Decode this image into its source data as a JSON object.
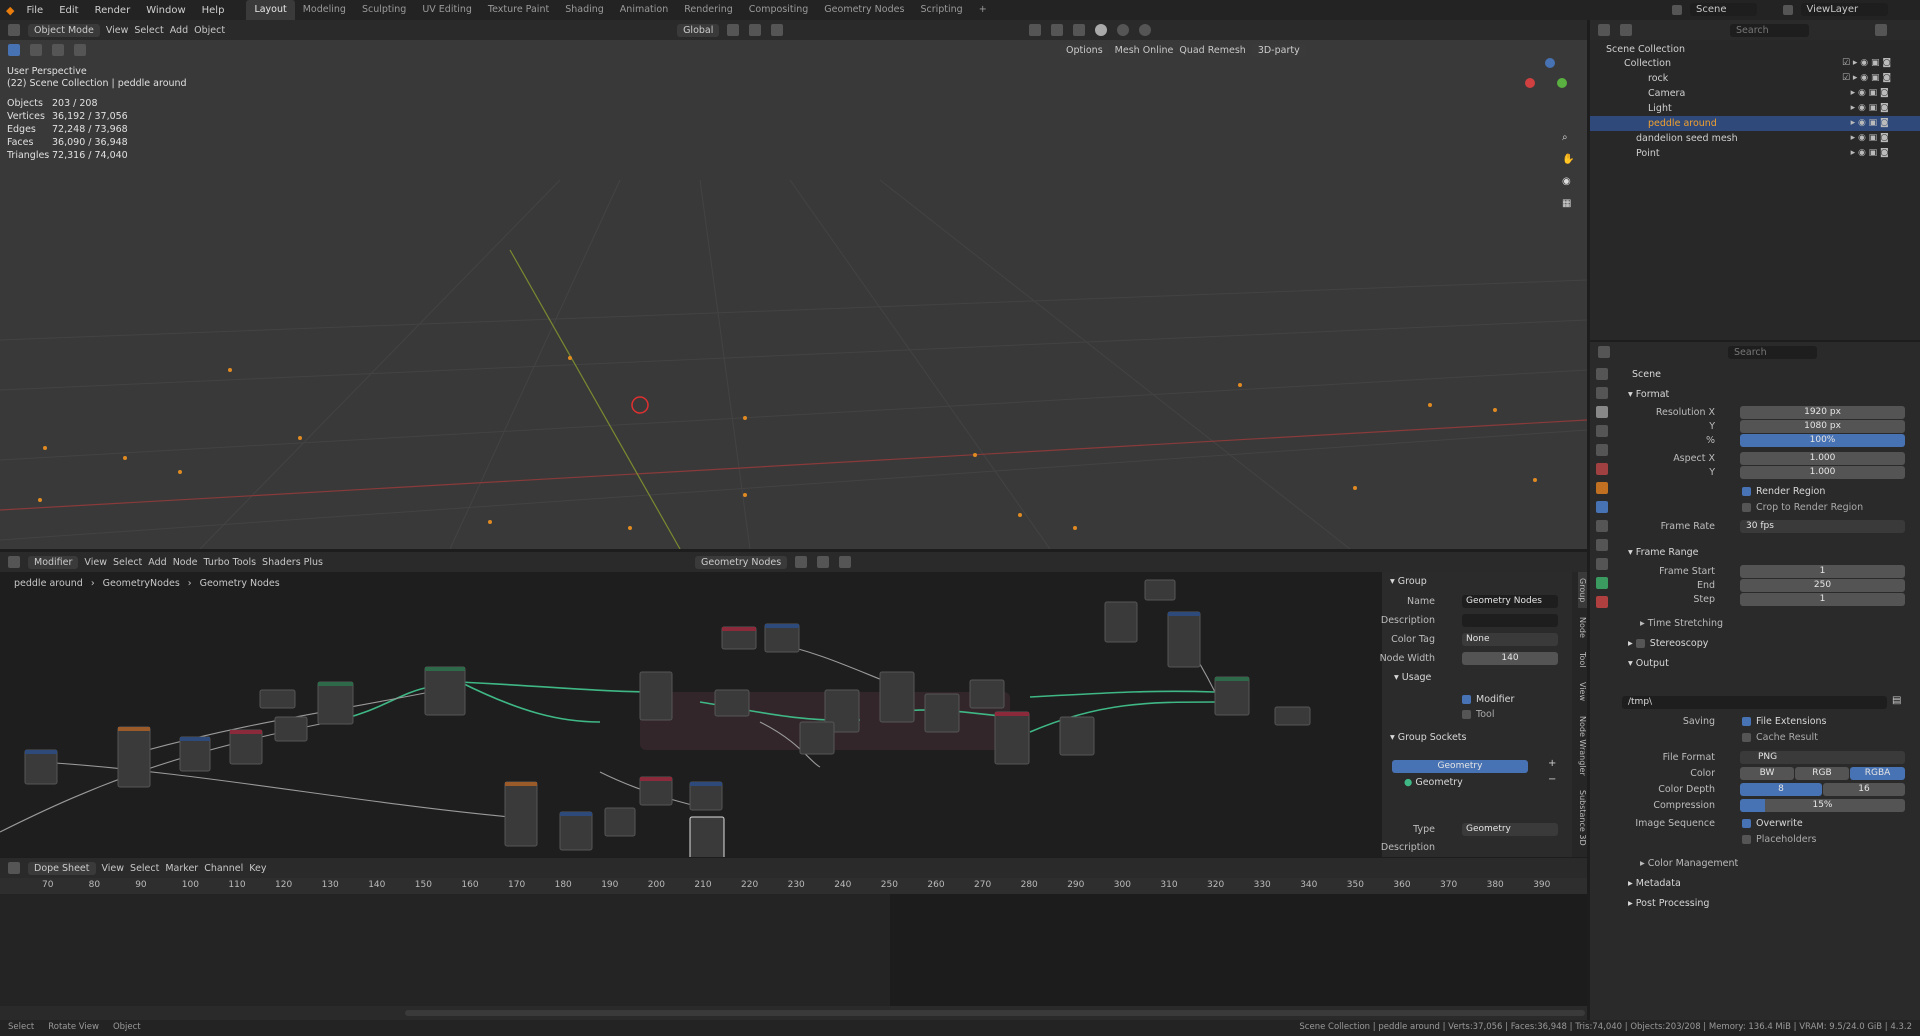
{
  "topbar": {
    "menus": [
      "File",
      "Edit",
      "Render",
      "Window",
      "Help"
    ],
    "workspaces": [
      "Layout",
      "Modeling",
      "Sculpting",
      "UV Editing",
      "Texture Paint",
      "Shading",
      "Animation",
      "Rendering",
      "Compositing",
      "Geometry Nodes",
      "Scripting"
    ],
    "active_workspace": "Layout",
    "scene": "Scene",
    "view_layer": "ViewLayer"
  },
  "viewport_header": {
    "mode": "Object Mode",
    "menus": [
      "View",
      "Select",
      "Add",
      "Object"
    ],
    "transform": "Global",
    "options": "Options",
    "addons": [
      "Mesh Online",
      "Quad Remesh",
      "3D-party"
    ]
  },
  "viewport": {
    "perspective": "User Perspective",
    "collection": "(22) Scene Collection | peddle around",
    "stats": [
      {
        "label": "Objects",
        "value": "203 / 208"
      },
      {
        "label": "Vertices",
        "value": "36,192 / 37,056"
      },
      {
        "label": "Edges",
        "value": "72,248 / 73,968"
      },
      {
        "label": "Faces",
        "value": "36,090 / 36,948"
      },
      {
        "label": "Triangles",
        "value": "72,316 / 74,040"
      }
    ]
  },
  "outliner": {
    "search_placeholder": "Search",
    "items": [
      {
        "label": "Scene Collection",
        "depth": 0
      },
      {
        "label": "Collection",
        "depth": 1
      },
      {
        "label": "rock",
        "depth": 2
      },
      {
        "label": "Camera",
        "depth": 2
      },
      {
        "label": "Light",
        "depth": 2
      },
      {
        "label": "peddle around",
        "depth": 2,
        "selected": true
      },
      {
        "label": "dandelion seed mesh",
        "depth": 1
      },
      {
        "label": "Point",
        "depth": 1
      }
    ]
  },
  "properties": {
    "search_placeholder": "Search",
    "scene": "Scene",
    "format_title": "Format",
    "resolution_x_label": "Resolution X",
    "resolution_x": "1920 px",
    "y_label": "Y",
    "resolution_y": "1080 px",
    "percent_label": "%",
    "percent": "100%",
    "aspect_x_label": "Aspect X",
    "aspect_x": "1.000",
    "aspect_y": "1.000",
    "render_region": "Render Region",
    "crop_region": "Crop to Render Region",
    "frame_rate_label": "Frame Rate",
    "frame_rate": "30 fps",
    "frame_range_title": "Frame Range",
    "frame_start_label": "Frame Start",
    "frame_start": "1",
    "end_label": "End",
    "frame_end": "250",
    "step_label": "Step",
    "step": "1",
    "time_stretching": "Time Stretching",
    "stereoscopy": "Stereoscopy",
    "output_title": "Output",
    "output_path": "/tmp\\",
    "saving_label": "Saving",
    "file_extensions": "File Extensions",
    "cache_result": "Cache Result",
    "file_format_label": "File Format",
    "file_format": "PNG",
    "color_label": "Color",
    "color_options": [
      "BW",
      "RGB",
      "RGBA"
    ],
    "color_depth_label": "Color Depth",
    "color_depth_options": [
      "8",
      "16"
    ],
    "compression_label": "Compression",
    "compression": "15%",
    "compression_fraction": 0.15,
    "image_sequence_label": "Image Sequence",
    "overwrite": "Overwrite",
    "placeholders": "Placeholders",
    "color_management": "Color Management",
    "metadata": "Metadata",
    "post_processing": "Post Processing"
  },
  "node_editor": {
    "mode": "Modifier",
    "menus": [
      "View",
      "Select",
      "Add",
      "Node",
      "Turbo Tools",
      "Shaders Plus"
    ],
    "tree_name": "Geometry Nodes",
    "breadcrumb": [
      "peddle around",
      "GeometryNodes",
      "Geometry Nodes"
    ],
    "side_tabs": [
      "Group",
      "Node",
      "Tool",
      "View",
      "Node Wrangler",
      "Substance 3D"
    ]
  },
  "group_panel": {
    "group_title": "Group",
    "name_label": "Name",
    "name": "Geometry Nodes",
    "description_label": "Description",
    "color_tag_label": "Color Tag",
    "color_tag": "None",
    "node_width_label": "Node Width",
    "node_width": "140",
    "usage_title": "Usage",
    "modifier": "Modifier",
    "tool": "Tool",
    "sockets_title": "Group Sockets",
    "socket_output": "Geometry",
    "socket_input": "Geometry",
    "type_label": "Type",
    "type": "Geometry",
    "description2_label": "Description"
  },
  "dopesheet": {
    "mode": "Dope Sheet",
    "menus": [
      "View",
      "Select",
      "Marker",
      "Channel",
      "Key"
    ],
    "frames": [
      "70",
      "80",
      "90",
      "100",
      "110",
      "120",
      "130",
      "140",
      "150",
      "160",
      "170",
      "180",
      "190",
      "200",
      "210",
      "220",
      "230",
      "240",
      "250",
      "260",
      "270",
      "280",
      "290",
      "300",
      "310",
      "320",
      "330",
      "340",
      "350",
      "360",
      "370",
      "380",
      "390"
    ]
  },
  "statusbar": {
    "left": [
      "Select",
      "Rotate View",
      "Object"
    ],
    "right": "Scene Collection | peddle around | Verts:37,056 | Faces:36,948 | Tris:74,040 | Objects:203/208 | Memory: 136.4 MiB | VRAM: 9.5/24.0 GiB | 4.3.2"
  },
  "colors": {
    "accent": "#4772b3",
    "node_link": "#3fb886",
    "selected": "#2f4a7a"
  }
}
